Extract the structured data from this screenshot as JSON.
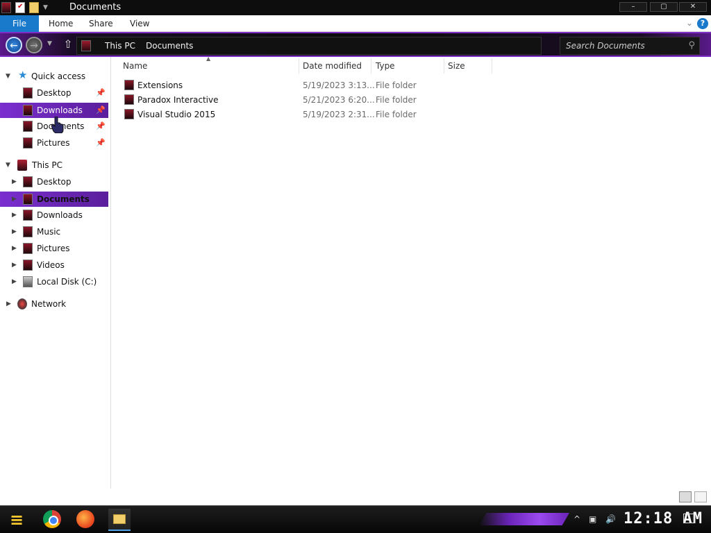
{
  "window": {
    "title": "Documents",
    "controls": {
      "minimize": "–",
      "maximize": "▢",
      "close": "✕"
    }
  },
  "ribbon": {
    "tabs": [
      "File",
      "Home",
      "Share",
      "View"
    ],
    "expand_icon": "chevron-down",
    "help_label": "?"
  },
  "address": {
    "crumbs": [
      "This PC",
      "Documents"
    ],
    "search_placeholder": "Search Documents"
  },
  "sidebar": {
    "quick_access": {
      "label": "Quick access",
      "items": [
        {
          "label": "Desktop",
          "pinned": true
        },
        {
          "label": "Downloads",
          "pinned": true,
          "selected": true
        },
        {
          "label": "Documents",
          "pinned": true
        },
        {
          "label": "Pictures",
          "pinned": true
        }
      ]
    },
    "this_pc": {
      "label": "This PC",
      "items": [
        {
          "label": "Desktop"
        },
        {
          "label": "Documents",
          "selected": true
        },
        {
          "label": "Downloads"
        },
        {
          "label": "Music"
        },
        {
          "label": "Pictures"
        },
        {
          "label": "Videos"
        },
        {
          "label": "Local Disk (C:)"
        }
      ]
    },
    "network": {
      "label": "Network"
    }
  },
  "columns": [
    "Name",
    "Date modified",
    "Type",
    "Size"
  ],
  "files": [
    {
      "name": "Extensions",
      "date": "5/19/2023 3:13...",
      "type": "File folder"
    },
    {
      "name": "Paradox Interactive",
      "date": "5/21/2023 6:20...",
      "type": "File folder"
    },
    {
      "name": "Visual Studio 2015",
      "date": "5/19/2023 2:31...",
      "type": "File folder"
    }
  ],
  "taskbar": {
    "clock": "12:18 AM",
    "apps": [
      "Chrome",
      "Firefox",
      "File Explorer"
    ]
  },
  "colors": {
    "accent": "#7a2fcf",
    "file_tab": "#1979ca",
    "titlebar": "#0d0d0d"
  }
}
